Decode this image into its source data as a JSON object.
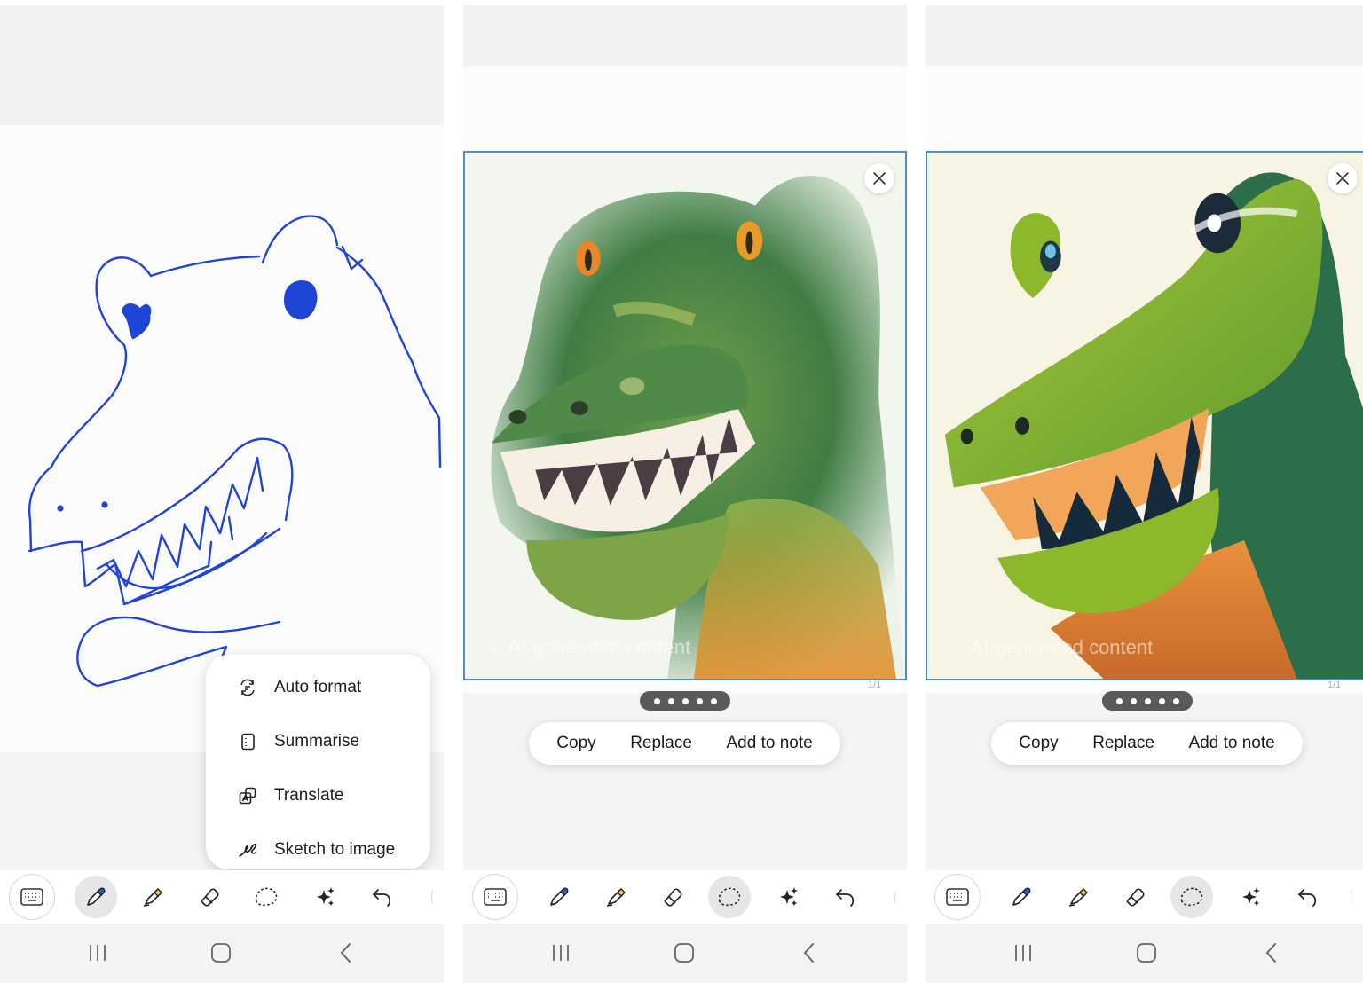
{
  "panels": [
    {
      "id": "sketch-with-menu",
      "menu": {
        "items": [
          {
            "label": "Auto format",
            "icon": "auto-format-icon"
          },
          {
            "label": "Summarise",
            "icon": "summarise-icon"
          },
          {
            "label": "Translate",
            "icon": "translate-icon"
          },
          {
            "label": "Sketch to image",
            "icon": "sketch-to-image-icon"
          }
        ]
      },
      "active_tool": "pen"
    },
    {
      "id": "watercolor-result",
      "result": {
        "watermark": "AI-generated content",
        "page": "1/1"
      },
      "actions": {
        "copy": "Copy",
        "replace": "Replace",
        "add": "Add to note"
      },
      "active_tool": "lasso"
    },
    {
      "id": "cartoon-result",
      "result": {
        "watermark": "AI-generated content",
        "page": "1/1"
      },
      "actions": {
        "copy": "Copy",
        "replace": "Replace",
        "add": "Add to note"
      },
      "active_tool": "lasso"
    }
  ],
  "toolbar": {
    "tools": [
      "keyboard-icon",
      "pen-icon",
      "highlighter-icon",
      "eraser-icon",
      "lasso-icon",
      "ai-sparkle-icon",
      "undo-icon"
    ]
  },
  "navbar": {
    "buttons": [
      "recent-apps-icon",
      "home-icon",
      "back-icon"
    ]
  },
  "colors": {
    "sketch_stroke": "#1f45d6",
    "frame_border": "#4a8dc7",
    "pen_accent": "#2a56d8"
  }
}
